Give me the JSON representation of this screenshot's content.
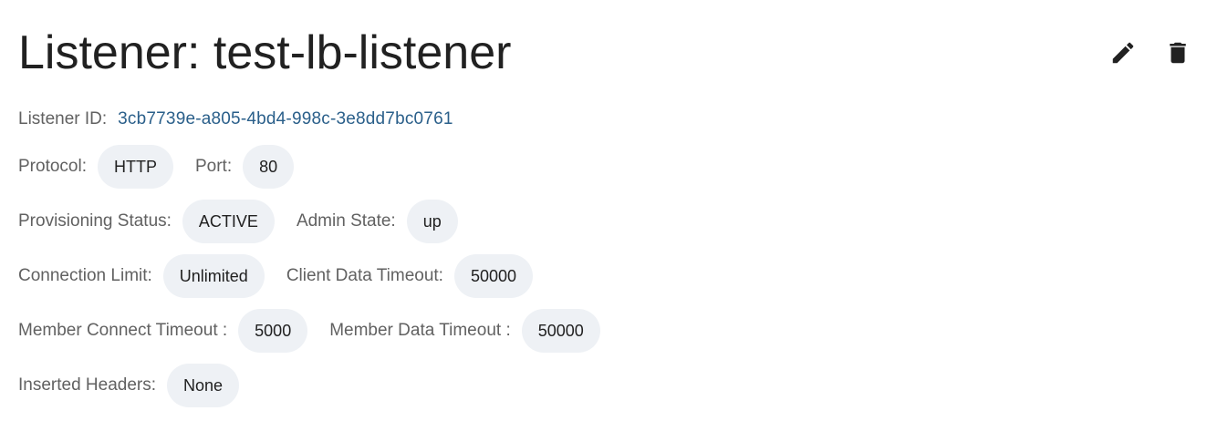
{
  "header": {
    "title": "Listener: test-lb-listener",
    "edit_icon": "pencil-icon",
    "delete_icon": "trash-icon"
  },
  "fields": {
    "listener_id": {
      "label": "Listener ID:",
      "value": "3cb7739e-a805-4bd4-998c-3e8dd7bc0761"
    },
    "protocol": {
      "label": "Protocol:",
      "value": "HTTP"
    },
    "port": {
      "label": "Port:",
      "value": "80"
    },
    "provisioning_status": {
      "label": "Provisioning Status:",
      "value": "ACTIVE"
    },
    "admin_state": {
      "label": "Admin State:",
      "value": "up"
    },
    "connection_limit": {
      "label": "Connection Limit:",
      "value": "Unlimited"
    },
    "client_data_timeout": {
      "label": "Client Data Timeout:",
      "value": "50000"
    },
    "member_connect_timeout": {
      "label": "Member Connect Timeout :",
      "value": "5000"
    },
    "member_data_timeout": {
      "label": "Member Data Timeout :",
      "value": "50000"
    },
    "inserted_headers": {
      "label": "Inserted Headers:",
      "value": "None"
    }
  },
  "colors": {
    "link": "#2a5f8a",
    "chip_bg": "#eef1f5",
    "label": "#616161",
    "text": "#212121"
  }
}
